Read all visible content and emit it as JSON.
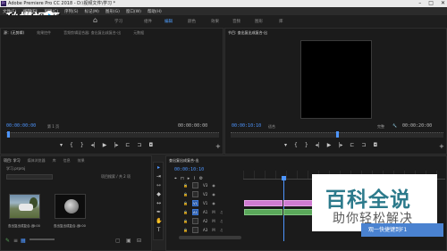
{
  "window": {
    "icon_text": "Pr",
    "title": "Adobe Premiere Pro CC 2018 - D:\\视频文件\\学习 *",
    "controls": [
      "–",
      "□",
      "✕"
    ]
  },
  "logo": {
    "text": "秒懂视频"
  },
  "menu": [
    "文件(F)",
    "编辑(E)",
    "剪辑(C)",
    "序列(S)",
    "标记(M)",
    "图形(G)",
    "窗口(W)",
    "帮助(H)"
  ],
  "workspaces": {
    "tabs": [
      "学习",
      "组件",
      "编辑",
      "颜色",
      "效果",
      "音频",
      "图形",
      "库"
    ],
    "active_index": 2
  },
  "source_monitor": {
    "tabs": [
      "源：(无剪辑)",
      "效果控件",
      "音频剪辑混合器: 查出复出成复合-出",
      "元数据"
    ],
    "timecode_left": "00:00:00:00",
    "page_label": "第 1 页",
    "timecode_right": "00:00:00:00"
  },
  "program_monitor": {
    "tab": "节目: 查出复出成复合-出",
    "timecode_left": "00:00:10:10",
    "fit_label": "适合",
    "quality_label": "完整",
    "timecode_right": "00:00:20:00"
  },
  "project": {
    "tabs": [
      "项目: 学习",
      "媒体浏览器",
      "库",
      "信息",
      "效果"
    ],
    "file": "学习.prproj",
    "search_label": "项目搜索 / 共 2 项",
    "items": [
      {
        "caption": "查出复出成复合-出",
        "duration": "5:00"
      },
      {
        "caption": "查出复出成复合-出",
        "duration": "5:00"
      }
    ]
  },
  "timeline": {
    "tab": "查出复出成复合-出",
    "timecode": "00:00:10:10",
    "tracks": [
      {
        "id": "V3",
        "kind": "video"
      },
      {
        "id": "V2",
        "kind": "video"
      },
      {
        "id": "V1",
        "kind": "video"
      },
      {
        "id": "A1",
        "kind": "audio"
      },
      {
        "id": "A2",
        "kind": "audio"
      },
      {
        "id": "A3",
        "kind": "audio"
      }
    ],
    "track_icons": [
      "lock-icon",
      "eye-icon",
      "mute-m-icon",
      "solo-s-icon",
      "mic-icon"
    ]
  },
  "watermark": {
    "title": "百科全说",
    "subtitle": "助你轻松解决",
    "banner": "观一快捷键到F1"
  },
  "colors": {
    "accent_blue": "#4d95ff",
    "clip_video": "#cf7bd1",
    "clip_audio": "#5aa85a",
    "watermark_teal": "#2c7a8b"
  }
}
